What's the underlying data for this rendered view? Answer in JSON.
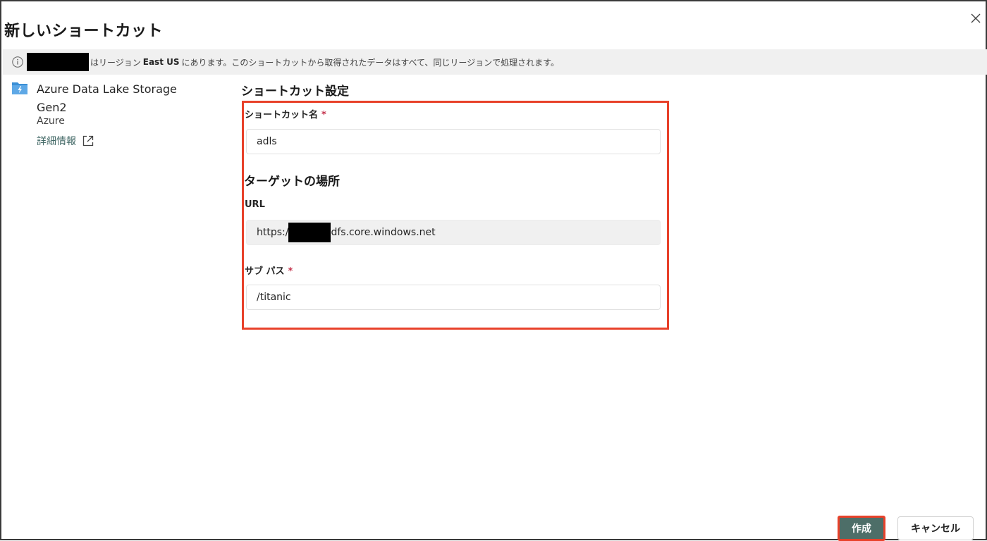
{
  "dialog": {
    "title": "新しいショートカット",
    "close_icon": "close-icon"
  },
  "info_bar": {
    "icon": "info-icon",
    "text_before_region": "はリージョン",
    "region": "East US",
    "text_after_region": "にあります。このショートカットから取得されたデータはすべて、同じリージョンで処理されます。"
  },
  "source": {
    "icon": "storage-folder-icon",
    "name": "Azure Data Lake Storage Gen2",
    "provider": "Azure",
    "link_label": "詳細情報",
    "link_icon": "external-link-icon"
  },
  "settings": {
    "heading": "ショートカット設定",
    "name_label": "ショートカット名",
    "name_value": "adls",
    "target_heading": "ターゲットの場所",
    "url_label": "URL",
    "url_prefix": "https:/",
    "url_suffix": "dfs.core.windows.net",
    "subpath_label": "サブ パス",
    "subpath_value": "/titanic",
    "required_mark": "*"
  },
  "footer": {
    "create_label": "作成",
    "cancel_label": "キャンセル"
  },
  "colors": {
    "accent": "#4d6e68",
    "highlight_border": "#e8412a",
    "required": "#c4314b",
    "info_bar_bg": "#f0f0f0",
    "link": "#426866"
  }
}
